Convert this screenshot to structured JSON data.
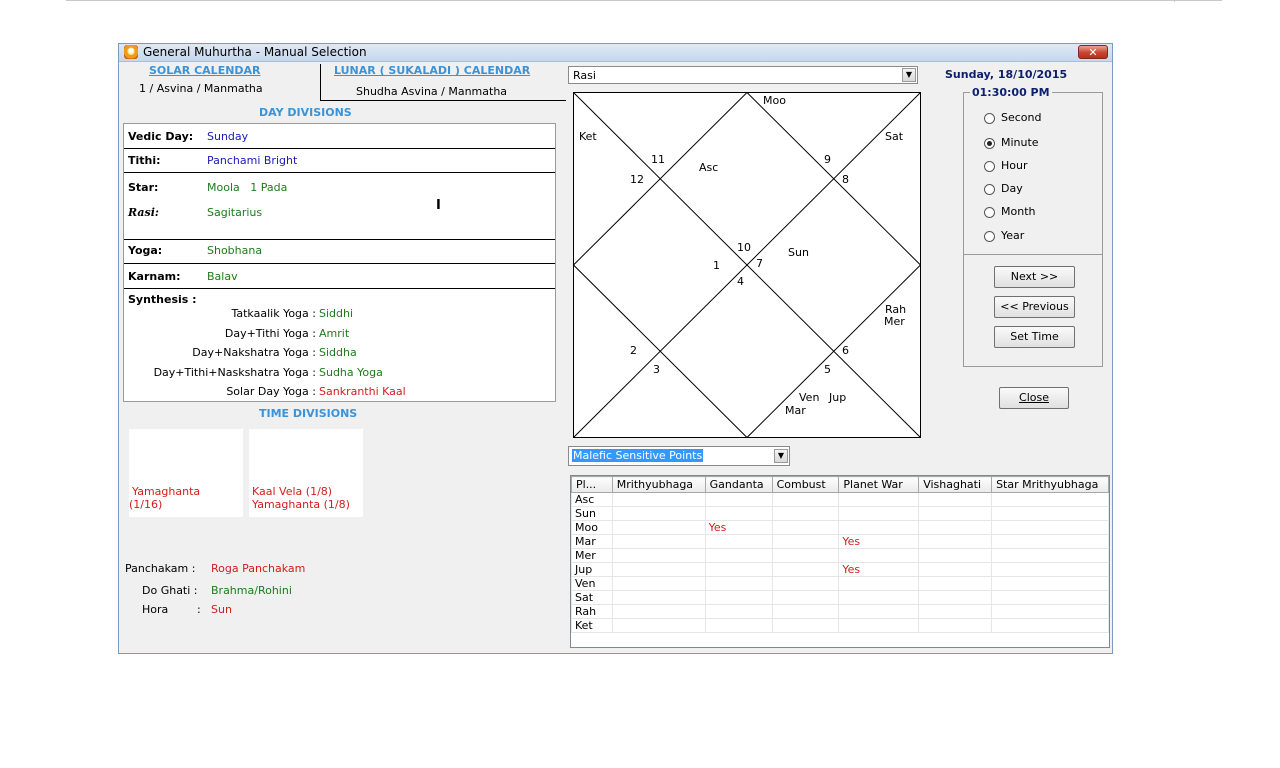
{
  "window": {
    "title": "General Muhurtha - Manual Selection",
    "close_glyph": "✕"
  },
  "calendars": {
    "solar_label": "SOLAR CALENDAR",
    "solar_value": "1 / Asvina / Manmatha",
    "lunar_label": "LUNAR ( SUKALADI ) CALENDAR",
    "lunar_value": "Shudha Asvina / Manmatha"
  },
  "day_divisions": {
    "heading": "DAY DIVISIONS",
    "vedic_day_label": "Vedic Day:",
    "vedic_day": "Sunday",
    "tithi_label": "Tithi:",
    "tithi": "Panchami Bright",
    "star_label": "Star:",
    "star": "Moola   1 Pada",
    "rasi_label": "Rasi:",
    "rasi": "Sagitarius",
    "cursor_glyph": "I",
    "yoga_label": "Yoga:",
    "yoga": "Shobhana",
    "karnam_label": "Karnam:",
    "karnam": "Balav",
    "synthesis_label": "Synthesis :",
    "synthesis": [
      {
        "label": "Tatkaalik Yoga :",
        "value": "Siddhi",
        "color": "green"
      },
      {
        "label": "Day+Tithi Yoga :",
        "value": "Amrit",
        "color": "green"
      },
      {
        "label": "Day+Nakshatra Yoga :",
        "value": "Siddha",
        "color": "green"
      },
      {
        "label": "Day+Tithi+Naskshatra Yoga :",
        "value": "Sudha Yoga",
        "color": "green"
      },
      {
        "label": "Solar Day Yoga :",
        "value": "Sankranthi Kaal",
        "color": "red"
      }
    ]
  },
  "time_divisions": {
    "heading": "TIME DIVISIONS",
    "box1_lines": [
      "Yamaghanta",
      "(1/16)"
    ],
    "box2_lines": [
      "Kaal Vela (1/8)",
      "Yamaghanta (1/8)"
    ]
  },
  "extras": {
    "panchakam_label": "Panchakam :",
    "panchakam": "Roga Panchakam",
    "doghati_label": "Do Ghati :",
    "doghati": "Brahma/Rohini",
    "hora_label": "Hora",
    "hora_colon": ":",
    "hora": "Sun"
  },
  "chart": {
    "selector": "Rasi",
    "dropdown_glyph": "▼",
    "house_numbers": [
      "1",
      "2",
      "3",
      "4",
      "5",
      "6",
      "7",
      "8",
      "9",
      "10",
      "11",
      "12"
    ],
    "planets": {
      "moo": "Moo",
      "ket": "Ket",
      "sat": "Sat",
      "asc": "Asc",
      "sun": "Sun",
      "rah": "Rah",
      "mer": "Mer",
      "ven": "Ven",
      "jup": "Jup",
      "mar": "Mar"
    }
  },
  "datetime": {
    "date": "Sunday, 18/10/2015",
    "time": "01:30:00 PM"
  },
  "step_options": {
    "items": [
      "Second",
      "Minute",
      "Hour",
      "Day",
      "Month",
      "Year"
    ],
    "selected": "Minute"
  },
  "buttons": {
    "next": "Next >>",
    "previous": "<< Previous",
    "set_time": "Set Time",
    "close": "Close"
  },
  "sensitive": {
    "selector": "Malefic Sensitive Points",
    "columns": [
      "Pl...",
      "Mrithyubhaga",
      "Gandanta",
      "Combust",
      "Planet War",
      "Vishaghati",
      "Star Mrithyubhaga"
    ],
    "rows": [
      [
        "Asc",
        "",
        "",
        "",
        "",
        "",
        ""
      ],
      [
        "Sun",
        "",
        "",
        "",
        "",
        "",
        ""
      ],
      [
        "Moo",
        "",
        "Yes",
        "",
        "",
        "",
        ""
      ],
      [
        "Mar",
        "",
        "",
        "",
        "Yes",
        "",
        ""
      ],
      [
        "Mer",
        "",
        "",
        "",
        "",
        "",
        ""
      ],
      [
        "Jup",
        "",
        "",
        "",
        "Yes",
        "",
        ""
      ],
      [
        "Ven",
        "",
        "",
        "",
        "",
        "",
        ""
      ],
      [
        "Sat",
        "",
        "",
        "",
        "",
        "",
        ""
      ],
      [
        "Rah",
        "",
        "",
        "",
        "",
        "",
        ""
      ],
      [
        "Ket",
        "",
        "",
        "",
        "",
        "",
        ""
      ]
    ]
  }
}
